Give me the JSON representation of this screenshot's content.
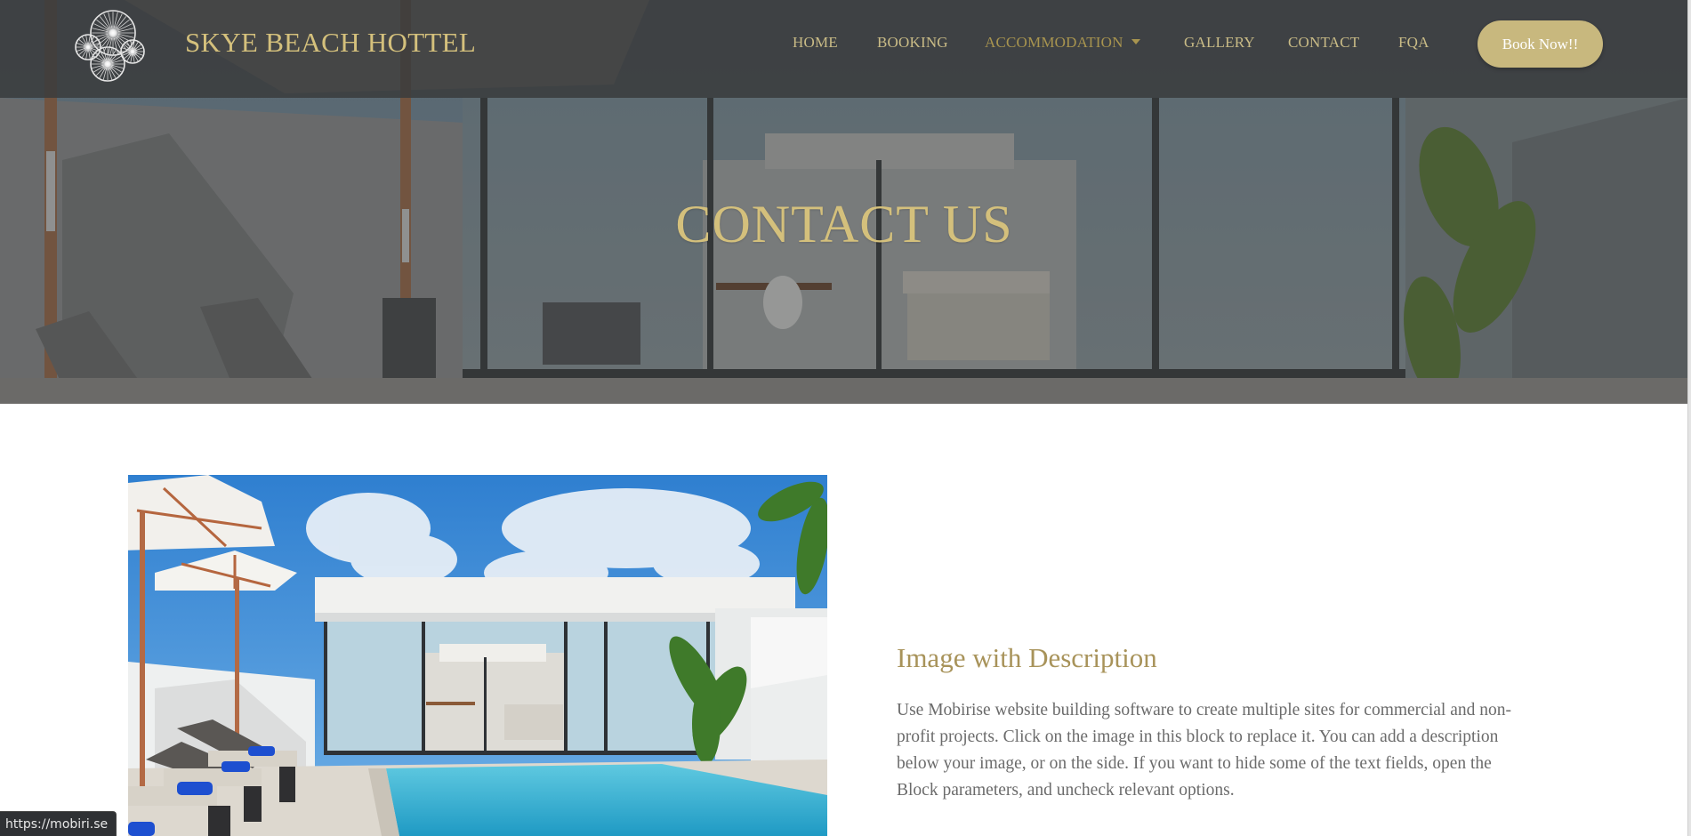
{
  "header": {
    "brand": "SKYE BEACH HOTTEL",
    "logo_icon": "spoked-wheels-logo",
    "nav": [
      {
        "label": "HOME",
        "active": false
      },
      {
        "label": "BOOKING",
        "active": false
      },
      {
        "label": "ACCOMMODATION",
        "active": true,
        "has_dropdown": true
      },
      {
        "label": "GALLERY",
        "active": false
      },
      {
        "label": "CONTACT",
        "active": false
      },
      {
        "label": "FQA",
        "active": false
      }
    ],
    "cta_label": "Book Now!!"
  },
  "hero": {
    "title": "CONTACT US",
    "background": "villa-terrace-photo"
  },
  "content": {
    "image": "pool-villa-photo",
    "title": "Image with Description",
    "body": "Use Mobirise website building software to create multiple sites for commercial and non-profit projects. Click on the image in this block to replace it. You can add a description below your image, or on the side. If you want to hide some of the text fields, open the Block parameters, and uncheck relevant options."
  },
  "status_bar": {
    "url": "https://mobiri.se"
  },
  "colors": {
    "gold": "#d4c07c",
    "nav_text": "#c9bb86",
    "nav_active": "#a8944f",
    "button_bg": "#c8b87e",
    "heading": "#a8935a",
    "body_text": "#6b6b6b",
    "navbar_bg": "#3a3b3c"
  }
}
